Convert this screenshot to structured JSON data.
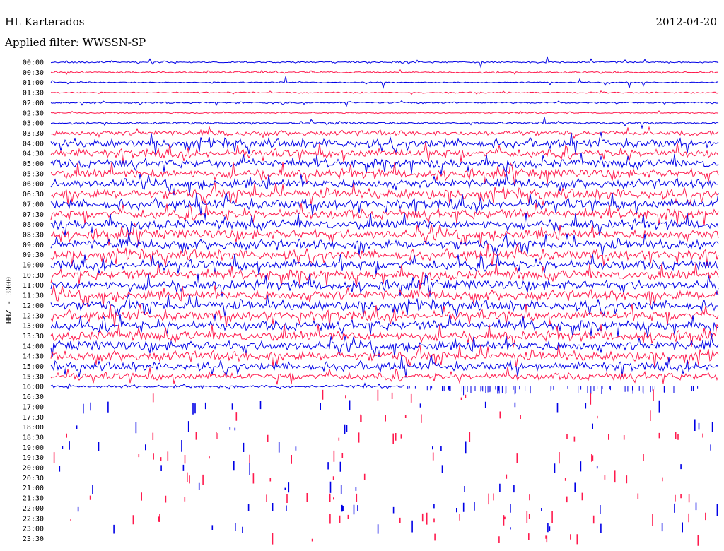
{
  "header": {
    "station": "HL Karterados",
    "date": "2012-04-20",
    "filter": "Applied filter: WWSSN-SP"
  },
  "colors": {
    "trace_a": "#0000e6",
    "trace_b": "#ff1a4d",
    "background": "#ffffff",
    "text": "#000000"
  },
  "chart_data": {
    "type": "line",
    "title": "HL Karterados",
    "subtitle": "Applied filter: WWSSN-SP",
    "ylabel": "HHZ - 3000",
    "xlabel": "",
    "row_labels": [
      "00:00",
      "00:30",
      "01:00",
      "01:30",
      "02:00",
      "02:30",
      "03:00",
      "03:30",
      "04:00",
      "04:30",
      "05:00",
      "05:30",
      "06:00",
      "06:30",
      "07:00",
      "07:30",
      "08:00",
      "08:30",
      "09:00",
      "09:30",
      "10:00",
      "10:30",
      "11:00",
      "11:30",
      "12:00",
      "12:30",
      "13:00",
      "13:30",
      "14:00",
      "14:30",
      "15:00",
      "15:30",
      "16:00",
      "16:30",
      "17:00",
      "17:30",
      "18:00",
      "18:30",
      "19:00",
      "19:30",
      "20:00",
      "20:30",
      "21:00",
      "21:30",
      "22:00",
      "22:30",
      "23:00",
      "23:30"
    ],
    "row_colors": [
      "blue",
      "red"
    ],
    "row_activity": [
      0.15,
      0.15,
      0.1,
      0.12,
      0.15,
      0.12,
      0.18,
      0.45,
      0.75,
      0.75,
      0.75,
      0.8,
      0.8,
      0.85,
      0.85,
      0.85,
      0.85,
      0.85,
      0.85,
      0.85,
      0.85,
      0.85,
      0.85,
      0.85,
      0.85,
      0.85,
      0.85,
      0.85,
      0.85,
      0.85,
      0.75,
      0.65,
      0.25,
      0.18,
      0.12,
      0.1,
      0.08,
      0.08,
      0.07,
      0.07,
      0.07,
      0.07,
      0.07,
      0.07,
      0.08,
      0.06,
      0.06,
      0.05
    ],
    "data_extent": "16:30 (partial, ends near x-fraction 0.53 of the row)",
    "grid": false,
    "legend": "none"
  }
}
